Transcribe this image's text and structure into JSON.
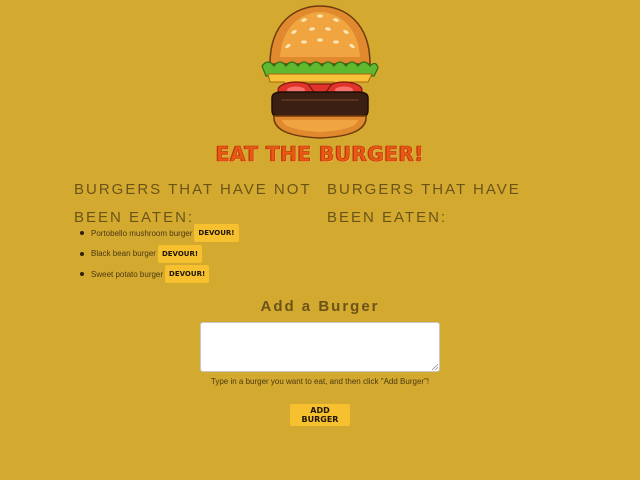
{
  "header": {
    "logo_icon": "burger-icon",
    "title": "EAT THE BURGER!"
  },
  "not_eaten": {
    "heading": "Burgers that have not been eaten:",
    "items": [
      {
        "name": "Portobello mushroom burger",
        "button": "DEVOUR!"
      },
      {
        "name": "Black bean burger",
        "button": "DEVOUR!"
      },
      {
        "name": "Sweet potato burger",
        "button": "DEVOUR!"
      }
    ]
  },
  "eaten": {
    "heading": "Burgers that have been eaten:",
    "items": []
  },
  "add_form": {
    "heading": "Add a Burger",
    "textarea_value": "",
    "help_text": "Type in a burger you want to eat, and then click \"Add Burger\"!",
    "submit_label": "ADD BURGER"
  },
  "colors": {
    "background": "#d4a930",
    "title": "#e85a14",
    "button": "#f7c02e",
    "heading_text": "#6b5418"
  }
}
